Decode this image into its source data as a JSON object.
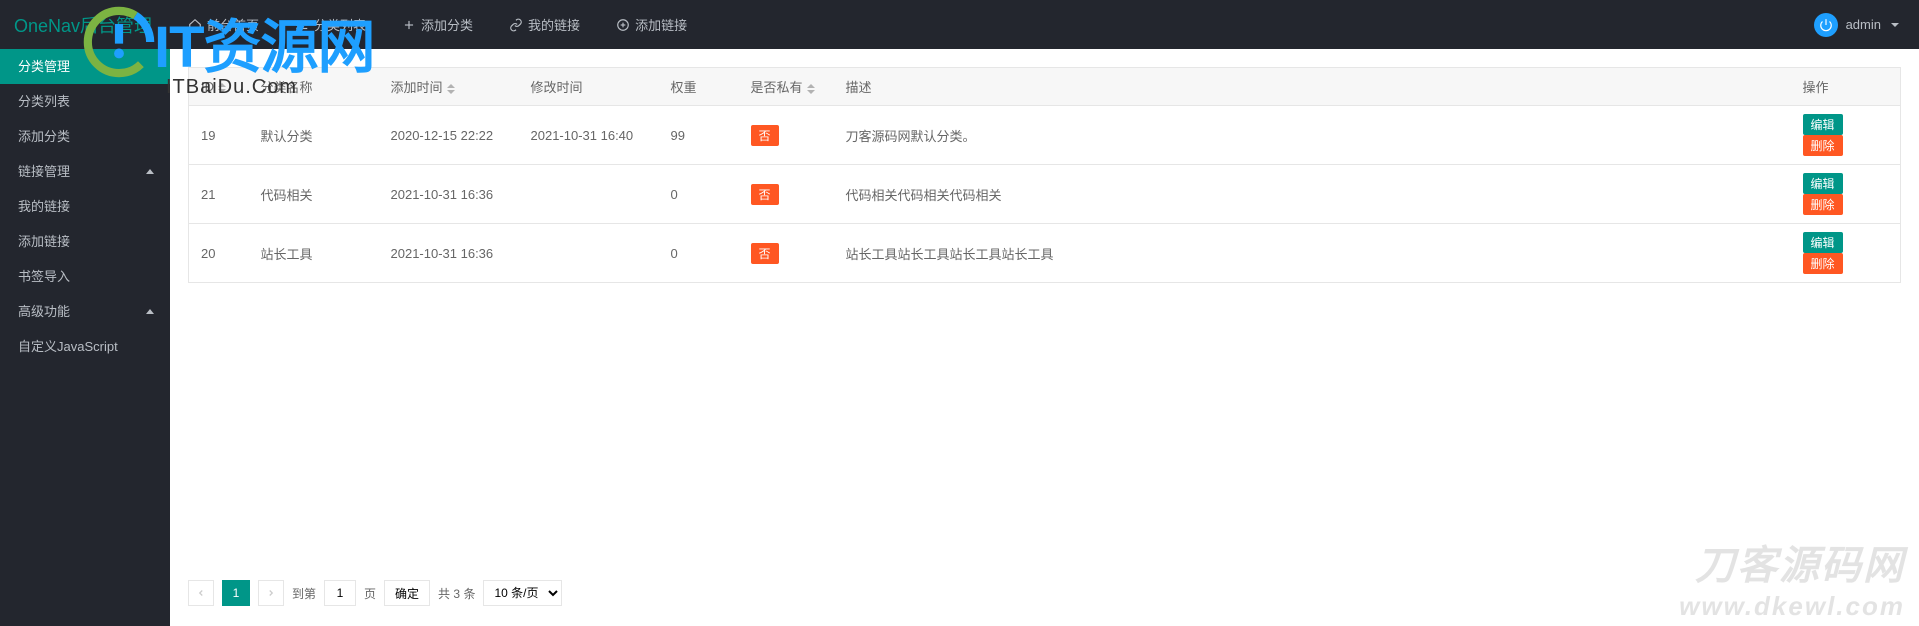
{
  "header": {
    "brand": "OneNav后台管理",
    "nav": [
      {
        "label": "前台首页",
        "icon": "home-icon"
      },
      {
        "label": "分类列表",
        "icon": "list-icon"
      },
      {
        "label": "添加分类",
        "icon": "plus-icon"
      },
      {
        "label": "我的链接",
        "icon": "link-icon"
      },
      {
        "label": "添加链接",
        "icon": "plus-circle-icon"
      }
    ],
    "user": "admin"
  },
  "sidebar": {
    "groups": [
      {
        "title": "分类管理",
        "active": true,
        "items": [
          {
            "label": "分类列表"
          },
          {
            "label": "添加分类"
          }
        ]
      },
      {
        "title": "链接管理",
        "items": [
          {
            "label": "我的链接"
          },
          {
            "label": "添加链接"
          },
          {
            "label": "书签导入"
          }
        ]
      },
      {
        "title": "高级功能",
        "items": [
          {
            "label": "自定义JavaScript"
          }
        ]
      }
    ]
  },
  "table": {
    "columns": {
      "id": "ID",
      "name": "分类名称",
      "add_time": "添加时间",
      "mod_time": "修改时间",
      "weight": "权重",
      "private": "是否私有",
      "desc": "描述",
      "ops": "操作"
    },
    "private_no": "否",
    "edit": "编辑",
    "delete": "删除",
    "rows": [
      {
        "id": "19",
        "name": "默认分类",
        "add_time": "2020-12-15 22:22",
        "mod_time": "2021-10-31 16:40",
        "weight": "99",
        "desc": "刀客源码网默认分类。"
      },
      {
        "id": "21",
        "name": "代码相关",
        "add_time": "2021-10-31 16:36",
        "mod_time": "",
        "weight": "0",
        "desc": "代码相关代码相关代码相关"
      },
      {
        "id": "20",
        "name": "站长工具",
        "add_time": "2021-10-31 16:36",
        "mod_time": "",
        "weight": "0",
        "desc": "站长工具站长工具站长工具站长工具"
      }
    ]
  },
  "pager": {
    "goto_label": "到第",
    "page_unit": "页",
    "confirm": "确定",
    "total_prefix": "共",
    "total_suffix": "条",
    "total": "3",
    "current": "1",
    "per_page": "10 条/页"
  },
  "watermark": {
    "logo_big": "IT资源网",
    "logo_sub": "ITBaiDu.Com",
    "text_l1": "刀客源码网",
    "text_l2": "www.dkewl.com"
  }
}
